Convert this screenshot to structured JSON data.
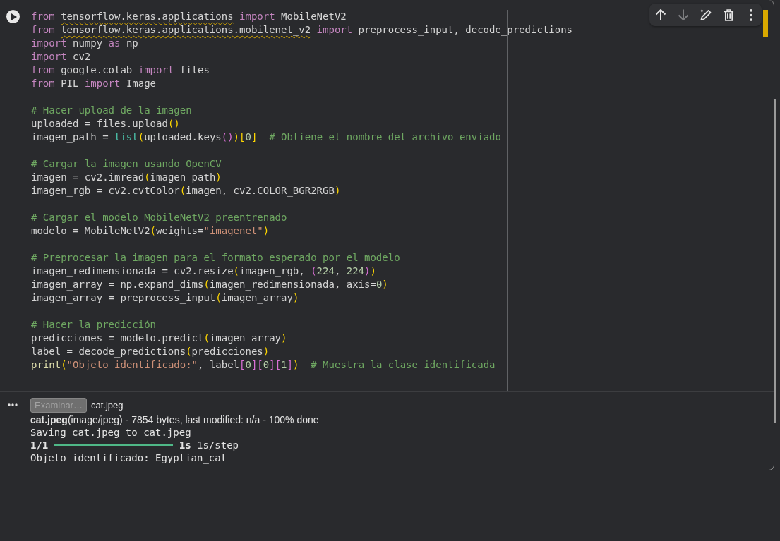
{
  "cell_toolbar": {
    "buttons": [
      {
        "kind": "up",
        "disabled": false
      },
      {
        "kind": "down",
        "disabled": true
      },
      {
        "kind": "edit",
        "disabled": false
      },
      {
        "kind": "delete",
        "disabled": false
      },
      {
        "kind": "more",
        "disabled": false
      }
    ]
  },
  "code": {
    "blocks": [
      [
        {
          "tokens": [
            {
              "text": "from ",
              "kind": "keyword"
            },
            {
              "text": "tensorflow.keras.applications",
              "kind": "module"
            },
            {
              "text": " import ",
              "kind": "keyword"
            },
            {
              "text": "MobileNetV2",
              "kind": "plain"
            }
          ]
        },
        {
          "tokens": [
            {
              "text": "from ",
              "kind": "keyword"
            },
            {
              "text": "tensorflow.keras.applications.mobilenet_v2",
              "kind": "module"
            },
            {
              "text": " import ",
              "kind": "keyword"
            },
            {
              "text": "preprocess_input, decode_predictions",
              "kind": "plain"
            }
          ]
        },
        {
          "tokens": [
            {
              "text": "import ",
              "kind": "keyword"
            },
            {
              "text": "numpy ",
              "kind": "plain"
            },
            {
              "text": "as ",
              "kind": "keyword"
            },
            {
              "text": "np",
              "kind": "plain"
            }
          ]
        },
        {
          "tokens": [
            {
              "text": "import ",
              "kind": "keyword"
            },
            {
              "text": "cv2",
              "kind": "plain"
            }
          ]
        },
        {
          "tokens": [
            {
              "text": "from ",
              "kind": "keyword"
            },
            {
              "text": "google.colab ",
              "kind": "plain"
            },
            {
              "text": "import ",
              "kind": "keyword"
            },
            {
              "text": "files",
              "kind": "plain"
            }
          ]
        },
        {
          "tokens": [
            {
              "text": "from ",
              "kind": "keyword"
            },
            {
              "text": "PIL ",
              "kind": "plain"
            },
            {
              "text": "import ",
              "kind": "keyword"
            },
            {
              "text": "Image",
              "kind": "plain"
            }
          ]
        }
      ],
      [
        {
          "tokens": [
            {
              "text": "# Hacer upload de la imagen",
              "kind": "comment"
            }
          ]
        },
        {
          "tokens": [
            {
              "text": "uploaded = files.upload",
              "kind": "plain"
            },
            {
              "text": "()",
              "kind": "bracket"
            }
          ]
        },
        {
          "tokens": [
            {
              "text": "imagen_path = ",
              "kind": "plain"
            },
            {
              "text": "list",
              "kind": "builtin"
            },
            {
              "text": "(",
              "kind": "bracket"
            },
            {
              "text": "uploaded.keys",
              "kind": "plain"
            },
            {
              "text": "()",
              "kind": "innerbracket"
            },
            {
              "text": ")[",
              "kind": "bracket"
            },
            {
              "text": "0",
              "kind": "number"
            },
            {
              "text": "]",
              "kind": "bracket"
            },
            {
              "text": "  # Obtiene el nombre del archivo enviado",
              "kind": "comment"
            }
          ]
        }
      ],
      [
        {
          "tokens": [
            {
              "text": "# Cargar la imagen usando OpenCV",
              "kind": "comment"
            }
          ]
        },
        {
          "tokens": [
            {
              "text": "imagen = cv2.imread",
              "kind": "plain"
            },
            {
              "text": "(",
              "kind": "bracket"
            },
            {
              "text": "imagen_path",
              "kind": "plain"
            },
            {
              "text": ")",
              "kind": "bracket"
            }
          ]
        },
        {
          "tokens": [
            {
              "text": "imagen_rgb = cv2.cvtColor",
              "kind": "plain"
            },
            {
              "text": "(",
              "kind": "bracket"
            },
            {
              "text": "imagen, cv2.COLOR_BGR2RGB",
              "kind": "plain"
            },
            {
              "text": ")",
              "kind": "bracket"
            }
          ]
        }
      ],
      [
        {
          "tokens": [
            {
              "text": "# Cargar el modelo MobileNetV2 preentrenado",
              "kind": "comment"
            }
          ]
        },
        {
          "tokens": [
            {
              "text": "modelo = MobileNetV2",
              "kind": "plain"
            },
            {
              "text": "(",
              "kind": "bracket"
            },
            {
              "text": "weights=",
              "kind": "plain"
            },
            {
              "text": "\"imagenet\"",
              "kind": "string"
            },
            {
              "text": ")",
              "kind": "bracket"
            }
          ]
        }
      ],
      [
        {
          "tokens": [
            {
              "text": "# Preprocesar la imagen para el formato esperado por el modelo",
              "kind": "comment"
            }
          ]
        },
        {
          "tokens": [
            {
              "text": "imagen_redimensionada = cv2.resize",
              "kind": "plain"
            },
            {
              "text": "(",
              "kind": "bracket"
            },
            {
              "text": "imagen_rgb, ",
              "kind": "plain"
            },
            {
              "text": "(",
              "kind": "innerbracket"
            },
            {
              "text": "224",
              "kind": "number"
            },
            {
              "text": ", ",
              "kind": "plain"
            },
            {
              "text": "224",
              "kind": "number"
            },
            {
              "text": ")",
              "kind": "innerbracket"
            },
            {
              "text": ")",
              "kind": "bracket"
            }
          ]
        },
        {
          "tokens": [
            {
              "text": "imagen_array = np.expand_dims",
              "kind": "plain"
            },
            {
              "text": "(",
              "kind": "bracket"
            },
            {
              "text": "imagen_redimensionada, axis=",
              "kind": "plain"
            },
            {
              "text": "0",
              "kind": "number"
            },
            {
              "text": ")",
              "kind": "bracket"
            }
          ]
        },
        {
          "tokens": [
            {
              "text": "imagen_array = preprocess_input",
              "kind": "plain"
            },
            {
              "text": "(",
              "kind": "bracket"
            },
            {
              "text": "imagen_array",
              "kind": "plain"
            },
            {
              "text": ")",
              "kind": "bracket"
            }
          ]
        }
      ],
      [
        {
          "tokens": [
            {
              "text": "# Hacer la predicción",
              "kind": "comment"
            }
          ]
        },
        {
          "tokens": [
            {
              "text": "predicciones = modelo.predict",
              "kind": "plain"
            },
            {
              "text": "(",
              "kind": "bracket"
            },
            {
              "text": "imagen_array",
              "kind": "plain"
            },
            {
              "text": ")",
              "kind": "bracket"
            }
          ]
        },
        {
          "tokens": [
            {
              "text": "label = decode_predictions",
              "kind": "plain"
            },
            {
              "text": "(",
              "kind": "bracket"
            },
            {
              "text": "predicciones",
              "kind": "plain"
            },
            {
              "text": ")",
              "kind": "bracket"
            }
          ]
        },
        {
          "tokens": [
            {
              "text": "print",
              "kind": "function"
            },
            {
              "text": "(",
              "kind": "bracket"
            },
            {
              "text": "\"Objeto identificado:\"",
              "kind": "string"
            },
            {
              "text": ", label",
              "kind": "plain"
            },
            {
              "text": "[",
              "kind": "innerbracket"
            },
            {
              "text": "0",
              "kind": "number"
            },
            {
              "text": "][",
              "kind": "innerbracket"
            },
            {
              "text": "0",
              "kind": "number"
            },
            {
              "text": "][",
              "kind": "innerbracket"
            },
            {
              "text": "1",
              "kind": "number"
            },
            {
              "text": "]",
              "kind": "innerbracket"
            },
            {
              "text": ")",
              "kind": "bracket"
            },
            {
              "text": "  # Muestra la clase identificada",
              "kind": "comment"
            }
          ]
        }
      ]
    ]
  },
  "output": {
    "upload": {
      "button": {
        "label": "Examinar…",
        "disabled": true
      },
      "file_name": "cat.jpeg"
    },
    "stream": [
      {
        "kind": "status",
        "text": "**cat.jpeg**(image/jpeg) - 7854 bytes, last modified: n/a - 100% done"
      },
      {
        "kind": "text",
        "text": "Saving cat.jpeg to cat.jpeg"
      },
      {
        "kind": "progress",
        "label": "1/1",
        "level": 1,
        "elapsed": "1s",
        "rate": "1s/step"
      },
      {
        "kind": "text",
        "text": "Objeto identificado: Egyptian_cat"
      }
    ]
  }
}
